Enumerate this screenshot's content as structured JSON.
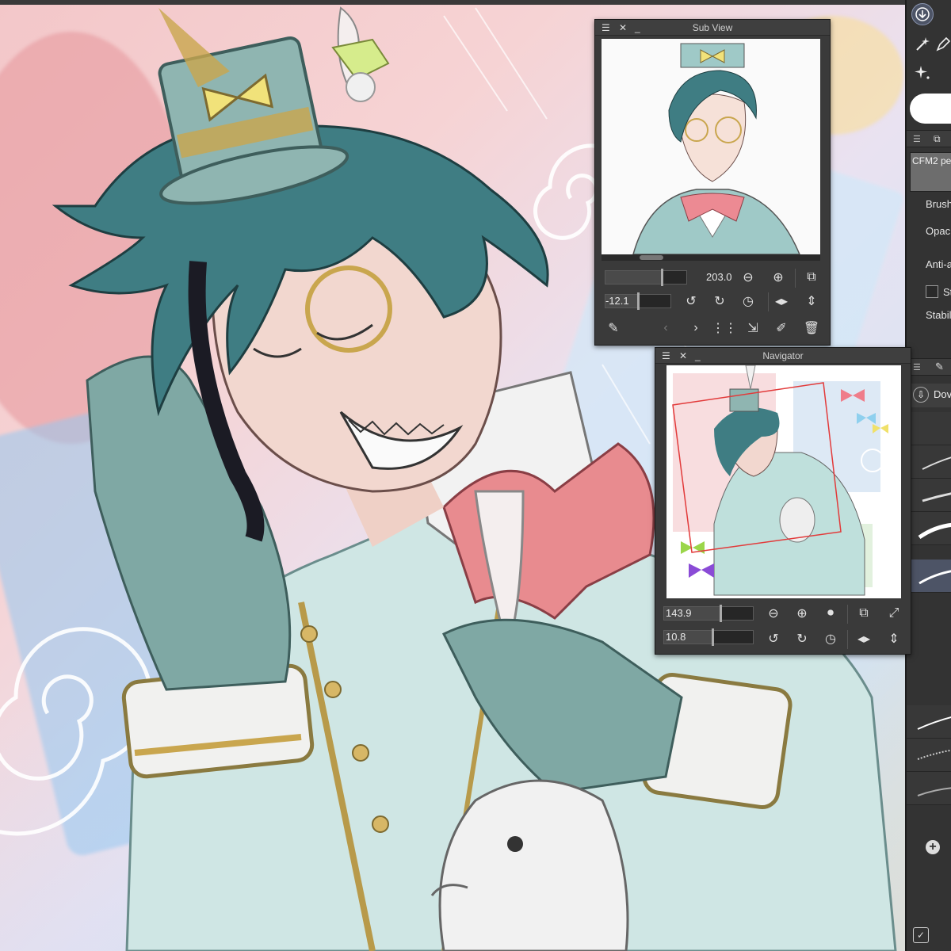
{
  "app": {
    "accent": "#4d5466",
    "panel_bg": "#3a3a3a"
  },
  "tool_strip": {
    "tool_icons": [
      "download-icon",
      "magic-wand-icon",
      "pen-icon",
      "sparkle-icon"
    ],
    "brush_name": "CFM2 pe",
    "properties": [
      {
        "label": "Brush",
        "icon": "slider-icon"
      },
      {
        "label": "Opac",
        "icon": "slider-icon"
      },
      {
        "label": "Anti-a",
        "icon": "none"
      },
      {
        "label": "St",
        "icon": "checkbox-icon"
      },
      {
        "label": "Stabil",
        "icon": "slider-icon"
      }
    ],
    "brush_list_header": "Dov",
    "brush_list_header_icon": "download-icon",
    "add_icon": "plus-circle-icon",
    "footer_icon": "checklist-icon"
  },
  "subview": {
    "title": "Sub View",
    "zoom_value": "203.0",
    "rotate_value": "-12.1",
    "controls": [
      "zoom-out-icon",
      "zoom-in-icon",
      "fit-icon",
      "rotate-left-icon",
      "rotate-right-icon",
      "reset-rotation-icon",
      "flip-horizontal-icon",
      "flip-vertical-icon",
      "eyedropper-icon",
      "prev-icon",
      "next-icon",
      "grid-icon",
      "import-icon",
      "edit-icon",
      "trash-icon"
    ]
  },
  "navigator": {
    "title": "Navigator",
    "zoom_value": "143.9",
    "rotate_value": "10.8",
    "view_frame_color": "#e23a3a",
    "controls": [
      "zoom-out-icon",
      "zoom-in-icon",
      "stop-icon",
      "fit-icon",
      "fill-icon",
      "rotate-left-icon",
      "rotate-right-icon",
      "reset-rotation-icon",
      "flip-horizontal-icon",
      "flip-vertical-icon"
    ]
  }
}
